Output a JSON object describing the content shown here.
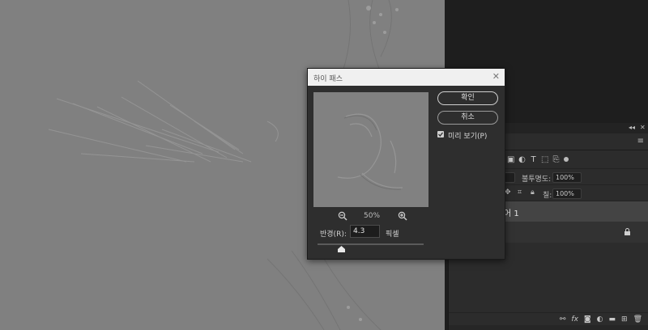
{
  "dialog": {
    "title": "하이 패스",
    "ok_label": "확인",
    "cancel_label": "취소",
    "preview_label": "미리 보기(P)",
    "preview_checked": true,
    "zoom_level": "50%",
    "radius_label": "반경(R):",
    "radius_value": "4.3",
    "unit_label": "픽셀"
  },
  "layers_panel": {
    "opacity_label": "불투명도:",
    "opacity_value": "100%",
    "fill_label": "칠:",
    "fill_value": "100%",
    "layer_name": "어 1"
  },
  "colors": {
    "canvas_gray": "#808080",
    "dialog_bg": "#2e2e2e",
    "titlebar_bg": "#f0f0f0",
    "panel_bg": "#2c2c2c"
  }
}
